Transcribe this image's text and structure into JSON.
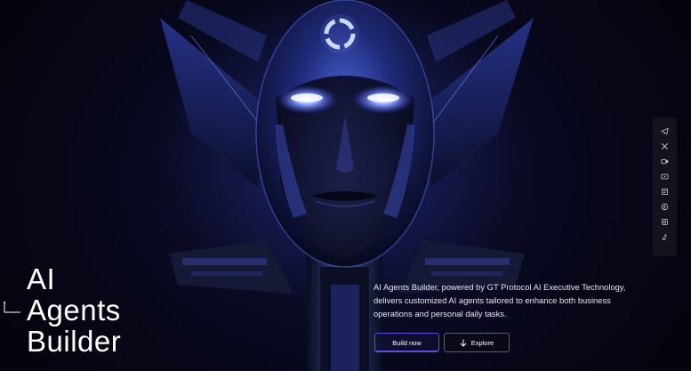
{
  "hero": {
    "title_line1": "AI",
    "title_line2": "Agents",
    "title_line3": "Builder",
    "description": "AI Agents Builder, powered by GT Protocol AI Executive Technology, delivers customized AI agents tailored to enhance both business operations and personal daily tasks.",
    "illustration": "robot-head-illustration"
  },
  "buttons": {
    "build_now": "Build now",
    "explore": "Explore",
    "explore_icon": "arrow-down-icon"
  },
  "social": [
    {
      "name": "telegram-icon"
    },
    {
      "name": "x-icon"
    },
    {
      "name": "video-icon"
    },
    {
      "name": "youtube-icon"
    },
    {
      "name": "medium-icon"
    },
    {
      "name": "facebook-icon"
    },
    {
      "name": "instagram-icon"
    },
    {
      "name": "tiktok-icon"
    }
  ],
  "colors": {
    "background": "#07071a",
    "accent": "#5a4fe0",
    "glow": "#4d6bff",
    "text": "#ffffff"
  }
}
